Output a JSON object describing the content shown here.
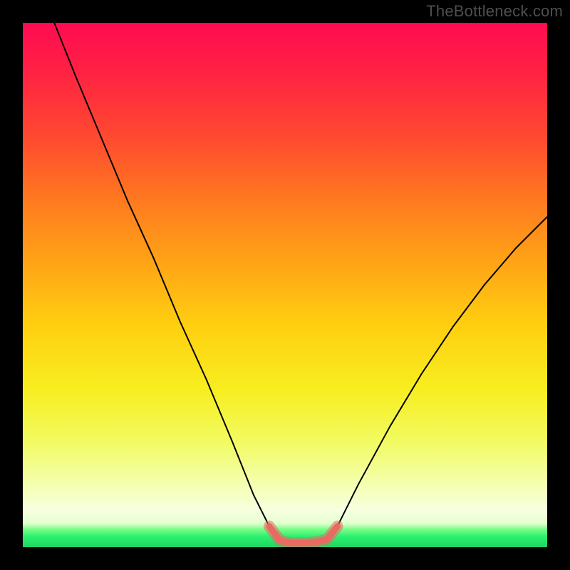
{
  "watermark": "TheBottleneck.com",
  "chart_data": {
    "type": "line",
    "title": "",
    "xlabel": "",
    "ylabel": "",
    "xlim": [
      0,
      100
    ],
    "ylim": [
      0,
      100
    ],
    "series": [
      {
        "name": "bottleneck-curve",
        "x": [
          6,
          10,
          15,
          20,
          25,
          30,
          35,
          40,
          44,
          47,
          49,
          51,
          54,
          56,
          58,
          60,
          64,
          70,
          76,
          82,
          88,
          94,
          100
        ],
        "values": [
          100,
          90,
          78,
          66,
          55,
          43,
          32,
          20,
          10,
          4,
          1.3,
          0.8,
          0.8,
          1.0,
          1.5,
          4,
          12,
          23,
          33,
          42,
          50,
          57,
          63
        ]
      },
      {
        "name": "valley-highlight",
        "x": [
          47,
          49,
          51,
          54,
          56,
          58,
          60
        ],
        "values": [
          4,
          1.3,
          0.8,
          0.8,
          1.0,
          1.5,
          4
        ]
      }
    ],
    "annotations": []
  }
}
